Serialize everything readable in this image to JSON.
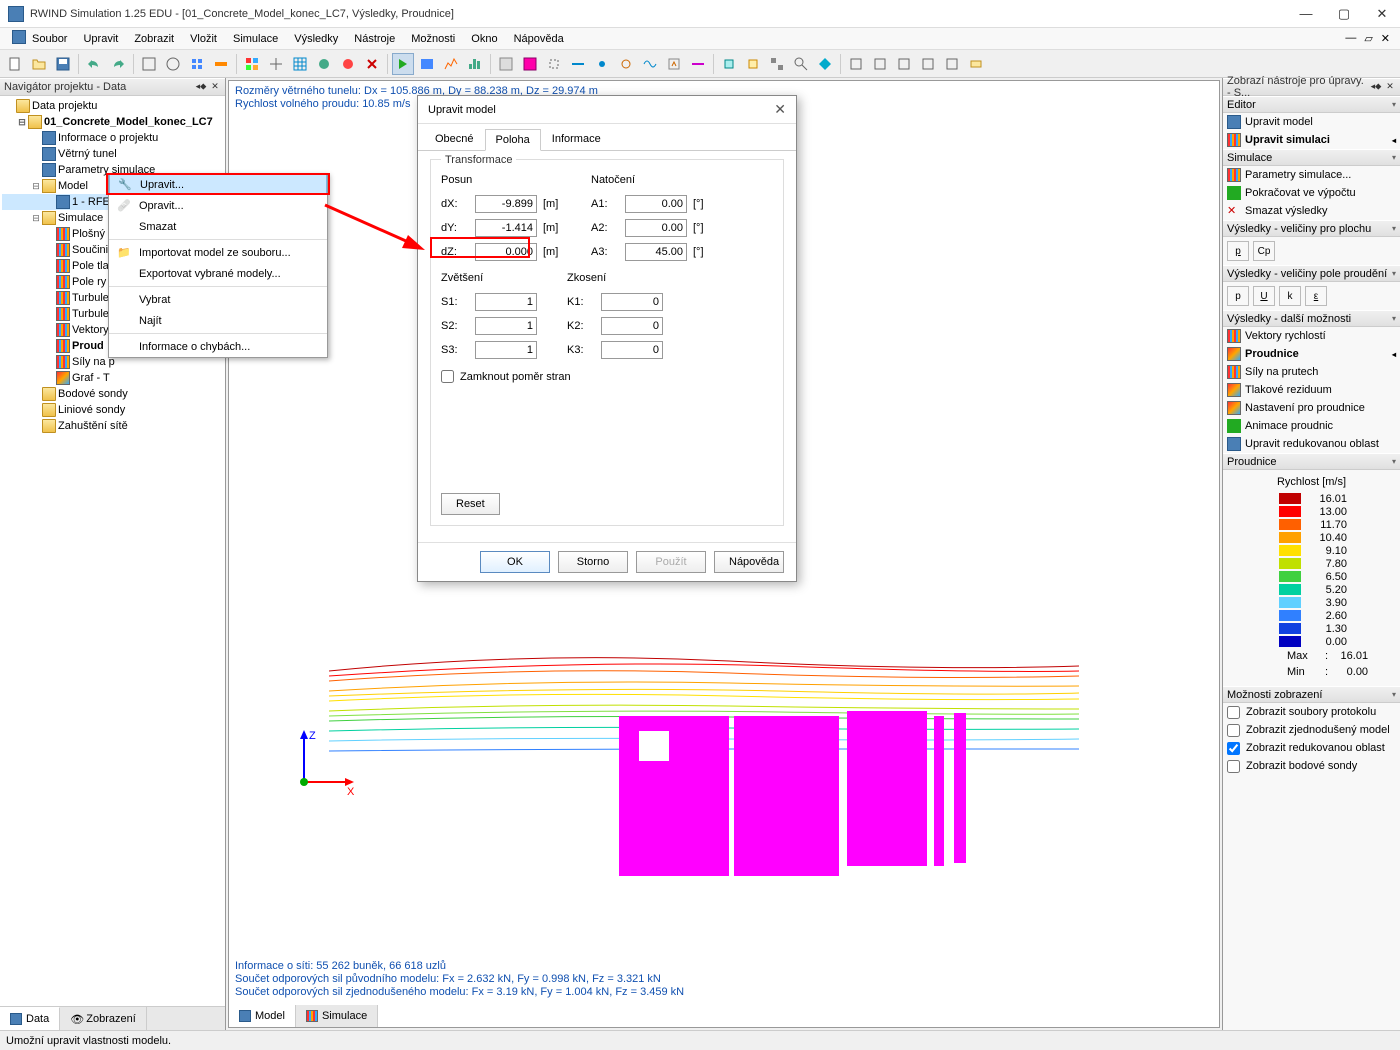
{
  "window": {
    "title": "RWIND Simulation 1.25 EDU - [01_Concrete_Model_konec_LC7, Výsledky, Proudnice]"
  },
  "menu": {
    "items": [
      "Soubor",
      "Upravit",
      "Zobrazit",
      "Vložit",
      "Simulace",
      "Výsledky",
      "Nástroje",
      "Možnosti",
      "Okno",
      "Nápověda"
    ]
  },
  "navigator": {
    "title": "Navigátor projektu - Data",
    "root": "Data projektu",
    "model_root": "01_Concrete_Model_konec_LC7",
    "items": {
      "info": "Informace o projektu",
      "tunnel": "Větrný tunel",
      "params": "Parametry simulace",
      "model": "Model",
      "rfe": "1 - RFE",
      "simulation": "Simulace",
      "plosny": "Plošný n",
      "soucini": "Součini",
      "poletla": "Pole tla",
      "polery": "Pole ry",
      "turbule1": "Turbule",
      "turbule2": "Turbule",
      "vektory": "Vektory",
      "proud": "Proud",
      "sily": "Síly na p",
      "graf": "Graf - T",
      "bodove": "Bodové sondy",
      "liniove": "Liniové sondy",
      "zahusteni": "Zahuštění sítě"
    },
    "tabs": {
      "data": "Data",
      "zobrazeni": "Zobrazení"
    }
  },
  "context_menu": {
    "upravit": "Upravit...",
    "opravit": "Opravit...",
    "smazat": "Smazat",
    "import": "Importovat model ze souboru...",
    "export": "Exportovat vybrané modely...",
    "vybrat": "Vybrat",
    "najit": "Najít",
    "chyby": "Informace o chybách..."
  },
  "viewport": {
    "line1": "Rozměry větrného tunelu: Dx = 105.886 m, Dy = 88.238 m, Dz = 29.974 m",
    "line2": "Rychlost volného proudu: 10.85 m/s",
    "bottom1": "Informace o síti: 55 262 buněk, 66 618 uzlů",
    "bottom2": "Součet odporových sil původního modelu: Fx = 2.632 kN, Fy = 0.998 kN, Fz = 3.321 kN",
    "bottom3": "Součet odporových sil zjednodušeného modelu: Fx = 3.19 kN, Fy = 1.004 kN, Fz = 3.459 kN",
    "tabs": {
      "model": "Model",
      "simulace": "Simulace"
    }
  },
  "dialog": {
    "title": "Upravit model",
    "tabs": {
      "obecne": "Obecné",
      "poloha": "Poloha",
      "informace": "Informace"
    },
    "group": "Transformace",
    "posun": "Posun",
    "natoceni": "Natočení",
    "zvetseni": "Zvětšení",
    "zkoseni": "Zkosení",
    "lock": "Zamknout poměr stran",
    "dx": "-9.899",
    "dy": "-1.414",
    "dz": "0.000",
    "a1": "0.00",
    "a2": "0.00",
    "a3": "45.00",
    "s1": "1",
    "s2": "1",
    "s3": "1",
    "k1": "0",
    "k2": "0",
    "k3": "0",
    "lbl_dx": "dX:",
    "lbl_dy": "dY:",
    "lbl_dz": "dZ:",
    "lbl_a1": "A1:",
    "lbl_a2": "A2:",
    "lbl_a3": "A3:",
    "lbl_s1": "S1:",
    "lbl_s2": "S2:",
    "lbl_s3": "S3:",
    "lbl_k1": "K1:",
    "lbl_k2": "K2:",
    "lbl_k3": "K3:",
    "unit_m": "[m]",
    "unit_deg": "[°]",
    "reset": "Reset",
    "ok": "OK",
    "storno": "Storno",
    "pouzit": "Použít",
    "napoveda": "Nápověda"
  },
  "right": {
    "title": "Zobrazí nástroje pro úpravy. - S...",
    "editor": "Editor",
    "upravit_model": "Upravit model",
    "upravit_sim": "Upravit simulaci",
    "simulace": "Simulace",
    "params": "Parametry simulace...",
    "continue": "Pokračovat ve výpočtu",
    "delete": "Smazat výsledky",
    "plocha": "Výsledky - veličiny pro plochu",
    "proudeni": "Výsledky - veličiny pole proudění",
    "btn_p": "p",
    "btn_u": "U",
    "btn_k": "k",
    "btn_e": "ε",
    "btn_cp": "Cp",
    "dalsi": "Výsledky - další možnosti",
    "vekt": "Vektory rychlostí",
    "proudnice": "Proudnice",
    "sily": "Síly na prutech",
    "tlak": "Tlakové reziduum",
    "nastav": "Nastavení pro proudnice",
    "anim": "Animace proudnic",
    "reduk": "Upravit redukovanou oblast",
    "proudnice_head": "Proudnice",
    "legend_title": "Rychlost [m/s]",
    "max": "Max",
    "min": "Min",
    "max_val": "16.01",
    "min_val": "0.00",
    "zobrazeni": "Možnosti zobrazení",
    "check1": "Zobrazit soubory protokolu",
    "check2": "Zobrazit zjednodušený model",
    "check3": "Zobrazit redukovanou oblast",
    "check4": "Zobrazit bodové sondy"
  },
  "legend": [
    {
      "c": "#c00000",
      "v": "16.01"
    },
    {
      "c": "#ff0000",
      "v": "13.00"
    },
    {
      "c": "#ff6000",
      "v": "11.70"
    },
    {
      "c": "#ffa000",
      "v": "10.40"
    },
    {
      "c": "#ffe000",
      "v": "9.10"
    },
    {
      "c": "#c0e000",
      "v": "7.80"
    },
    {
      "c": "#40d040",
      "v": "6.50"
    },
    {
      "c": "#00d0a0",
      "v": "5.20"
    },
    {
      "c": "#60d0ff",
      "v": "3.90"
    },
    {
      "c": "#3080ff",
      "v": "2.60"
    },
    {
      "c": "#1040e0",
      "v": "1.30"
    },
    {
      "c": "#0000c0",
      "v": "0.00"
    }
  ],
  "status": "Umožní upravit vlastnosti modelu."
}
